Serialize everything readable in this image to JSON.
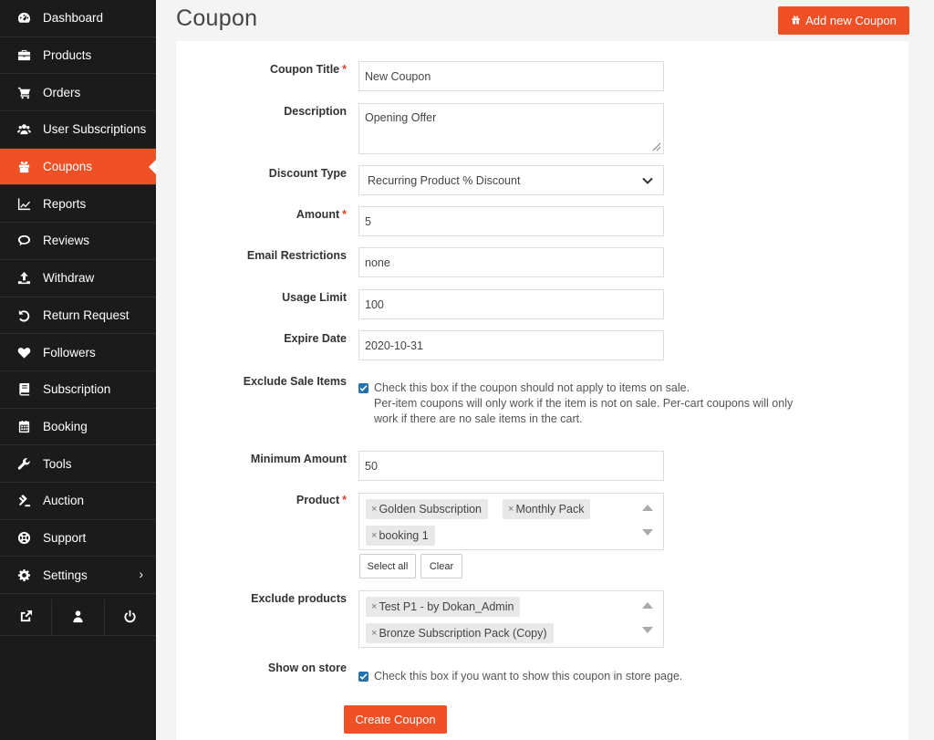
{
  "sidebar": {
    "items": [
      {
        "label": "Dashboard",
        "icon": "dashboard-icon"
      },
      {
        "label": "Products",
        "icon": "briefcase-icon"
      },
      {
        "label": "Orders",
        "icon": "cart-icon"
      },
      {
        "label": "User Subscriptions",
        "icon": "users-icon"
      },
      {
        "label": "Coupons",
        "icon": "gift-icon",
        "active": true
      },
      {
        "label": "Reports",
        "icon": "line-chart-icon"
      },
      {
        "label": "Reviews",
        "icon": "comments-icon"
      },
      {
        "label": "Withdraw",
        "icon": "upload-icon"
      },
      {
        "label": "Return Request",
        "icon": "undo-icon"
      },
      {
        "label": "Followers",
        "icon": "heart-icon"
      },
      {
        "label": "Subscription",
        "icon": "book-icon"
      },
      {
        "label": "Booking",
        "icon": "calendar-icon"
      },
      {
        "label": "Tools",
        "icon": "wrench-icon"
      },
      {
        "label": "Auction",
        "icon": "gavel-icon"
      },
      {
        "label": "Support",
        "icon": "lifebuoy-icon"
      },
      {
        "label": "Settings",
        "icon": "gear-icon"
      }
    ],
    "bottom_icons": [
      "external-link-icon",
      "user-icon",
      "power-icon"
    ]
  },
  "header": {
    "title": "Coupon",
    "add_button": "Add new Coupon"
  },
  "form": {
    "title_label": "Coupon Title",
    "title_value": "New Coupon",
    "description_label": "Description",
    "description_value": "Opening Offer",
    "discount_type_label": "Discount Type",
    "discount_type_value": "Recurring Product % Discount",
    "amount_label": "Amount",
    "amount_value": "5",
    "email_label": "Email Restrictions",
    "email_value": "none",
    "usage_label": "Usage Limit",
    "usage_value": "100",
    "expire_label": "Expire Date",
    "expire_value": "2020-10-31",
    "exclude_sale_label": "Exclude Sale Items",
    "exclude_sale_line1": "Check this box if the coupon should not apply to items on sale.",
    "exclude_sale_line2": "Per-item coupons will only work if the item is not on sale. Per-cart coupons will only",
    "exclude_sale_line3": "work if there are no sale items in the cart.",
    "min_amount_label": "Minimum Amount",
    "min_amount_value": "50",
    "product_label": "Product",
    "products": [
      "Golden Subscription",
      "Monthly Pack",
      "booking 1"
    ],
    "select_all": "Select all",
    "clear": "Clear",
    "exclude_products_label": "Exclude products",
    "exclude_products": [
      "Test P1 - by Dokan_Admin",
      "Bronze Subscription Pack (Copy)"
    ],
    "show_store_label": "Show on store",
    "show_store_text": "Check this box if you want to show this coupon in store page.",
    "required_mark": "*",
    "tag_remove": "×",
    "create_button": "Create Coupon"
  },
  "colors": {
    "accent": "#f05025",
    "sidebar_bg": "#1b1b1b",
    "checkbox": "#2271b1"
  }
}
